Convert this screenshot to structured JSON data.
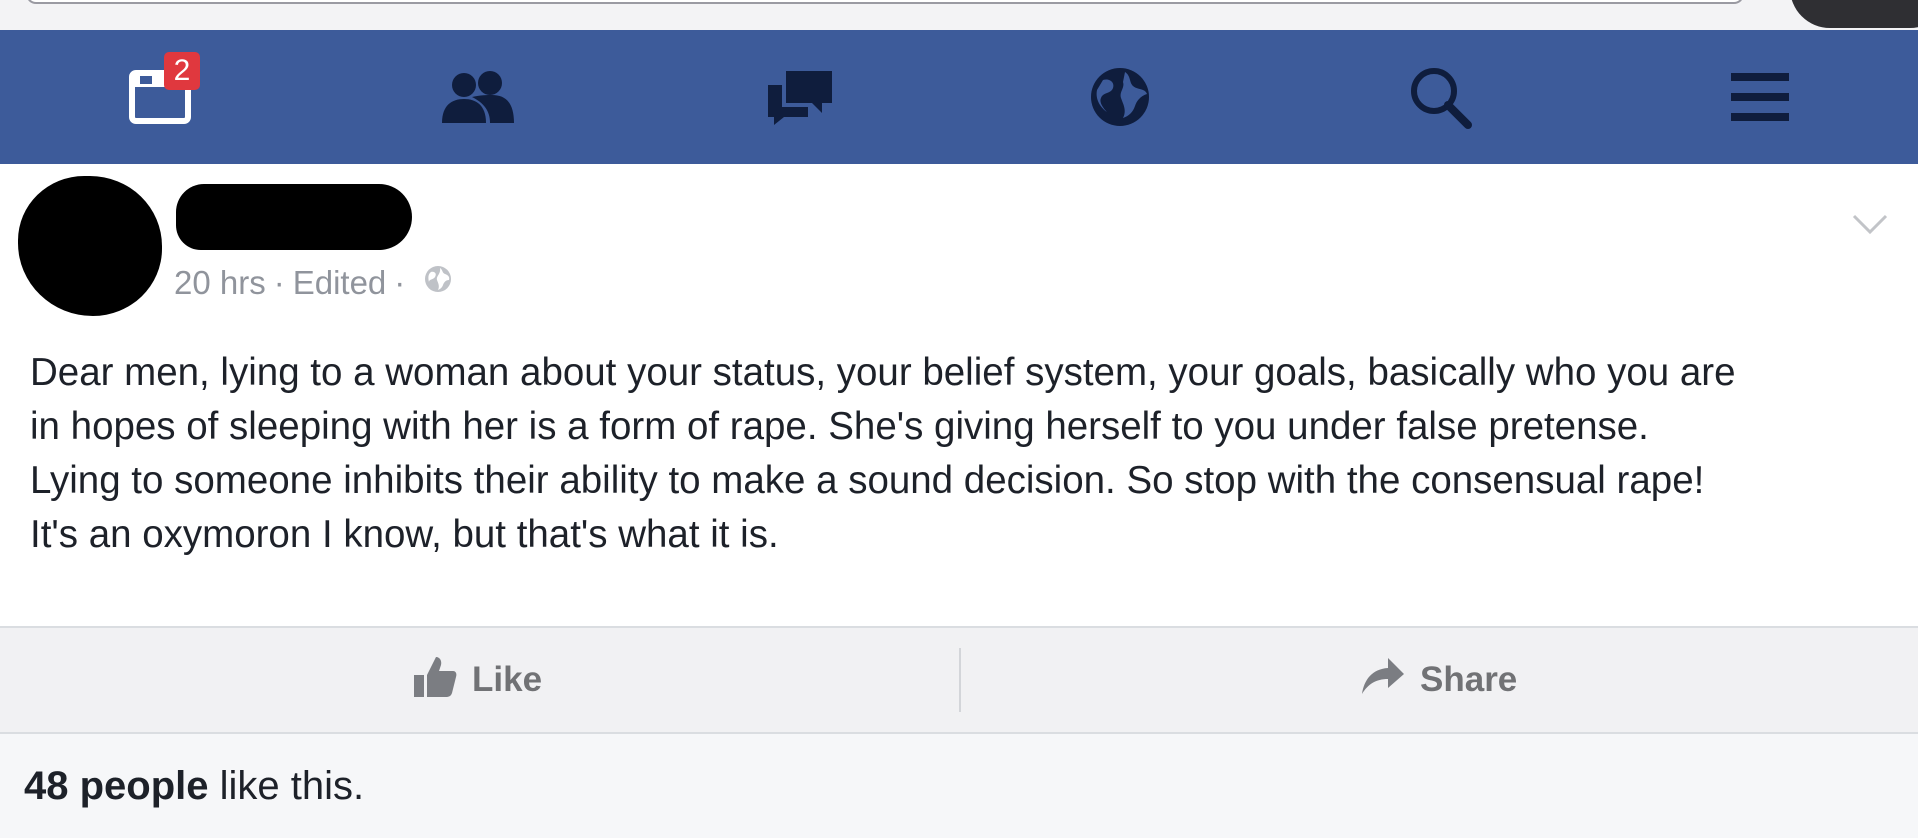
{
  "navbar": {
    "background": "#3d5b9a",
    "items": [
      {
        "icon": "news-feed-icon",
        "badge": "2"
      },
      {
        "icon": "friends-icon"
      },
      {
        "icon": "messages-icon"
      },
      {
        "icon": "notifications-globe-icon"
      },
      {
        "icon": "search-icon"
      },
      {
        "icon": "menu-icon"
      }
    ]
  },
  "post": {
    "time": "20 hrs",
    "edited": "Edited",
    "separator": "·",
    "privacy_icon": "public-globe-icon",
    "lines": [
      "Dear men, lying to a woman about your status, your belief system, your goals, basically who you are",
      "in hopes of sleeping with her is a form of rape. She's giving herself to you under false pretense.",
      "Lying to someone inhibits their ability to make a sound decision. So stop with the consensual rape!",
      "It's an oxymoron I know, but that's what it is."
    ]
  },
  "actions": {
    "like_label": "Like",
    "share_label": "Share"
  },
  "likes_summary": {
    "count": "48 people",
    "suffix": " like this."
  }
}
